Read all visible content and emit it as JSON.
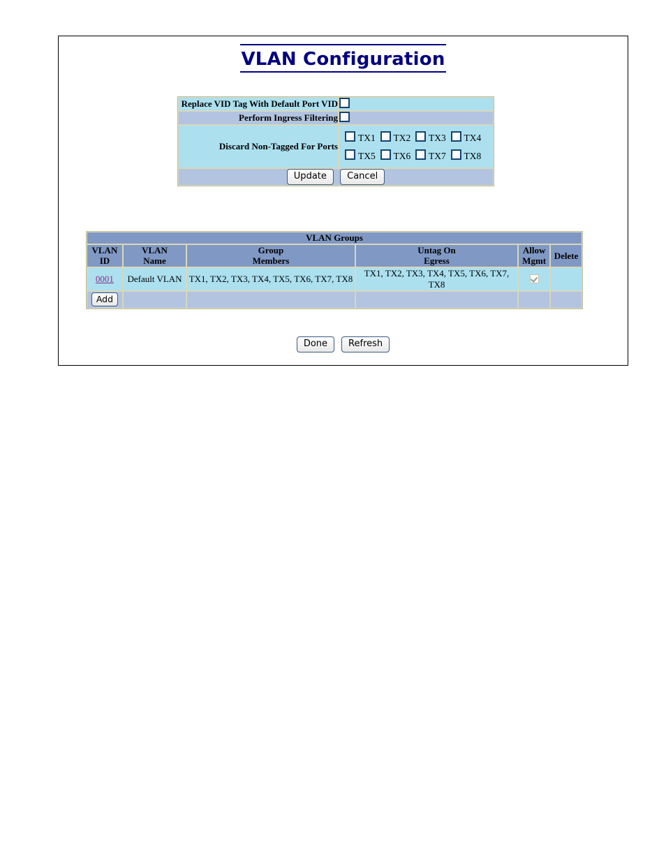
{
  "page": {
    "title": "VLAN Configuration"
  },
  "settings": {
    "rows": [
      {
        "label": "Replace VID Tag With Default Port VID",
        "checked": false
      },
      {
        "label": "Perform Ingress Filtering",
        "checked": false
      }
    ],
    "discard": {
      "label": "Discard Non-Tagged For Ports",
      "ports": [
        {
          "label": "TX1",
          "checked": false
        },
        {
          "label": "TX2",
          "checked": false
        },
        {
          "label": "TX3",
          "checked": false
        },
        {
          "label": "TX4",
          "checked": false
        },
        {
          "label": "TX5",
          "checked": false
        },
        {
          "label": "TX6",
          "checked": false
        },
        {
          "label": "TX7",
          "checked": false
        },
        {
          "label": "TX8",
          "checked": false
        }
      ]
    },
    "update_label": "Update",
    "cancel_label": "Cancel"
  },
  "vlan_groups": {
    "title": "VLAN Groups",
    "columns": [
      "VLAN\nID",
      "VLAN\nName",
      "Group\nMembers",
      "Untag On\nEgress",
      "Allow\nMgmt",
      "Delete"
    ],
    "columns_lines": {
      "vid_l1": "VLAN",
      "vid_l2": "ID",
      "vname_l1": "VLAN",
      "vname_l2": "Name",
      "gmem_l1": "Group",
      "gmem_l2": "Members",
      "untag_l1": "Untag On",
      "untag_l2": "Egress",
      "allow_l1": "Allow",
      "allow_l2": "Mgmt",
      "delete": "Delete"
    },
    "rows": [
      {
        "vlan_id": "0001",
        "vlan_name": "Default VLAN",
        "group_members": "TX1, TX2, TX3, TX4, TX5, TX6, TX7, TX8",
        "untag_on_egress": "TX1, TX2, TX3, TX4, TX5, TX6, TX7, TX8",
        "allow_mgmt": true,
        "delete": ""
      }
    ],
    "add_label": "Add"
  },
  "footer": {
    "done_label": "Done",
    "refresh_label": "Refresh"
  },
  "colors": {
    "title": "#000080",
    "row_cyan": "#ace0ef",
    "row_blue": "#b2c4e0",
    "header_blue": "#8098c4",
    "link_visited": "#8a2a8a",
    "border": "#d8d8bb"
  }
}
